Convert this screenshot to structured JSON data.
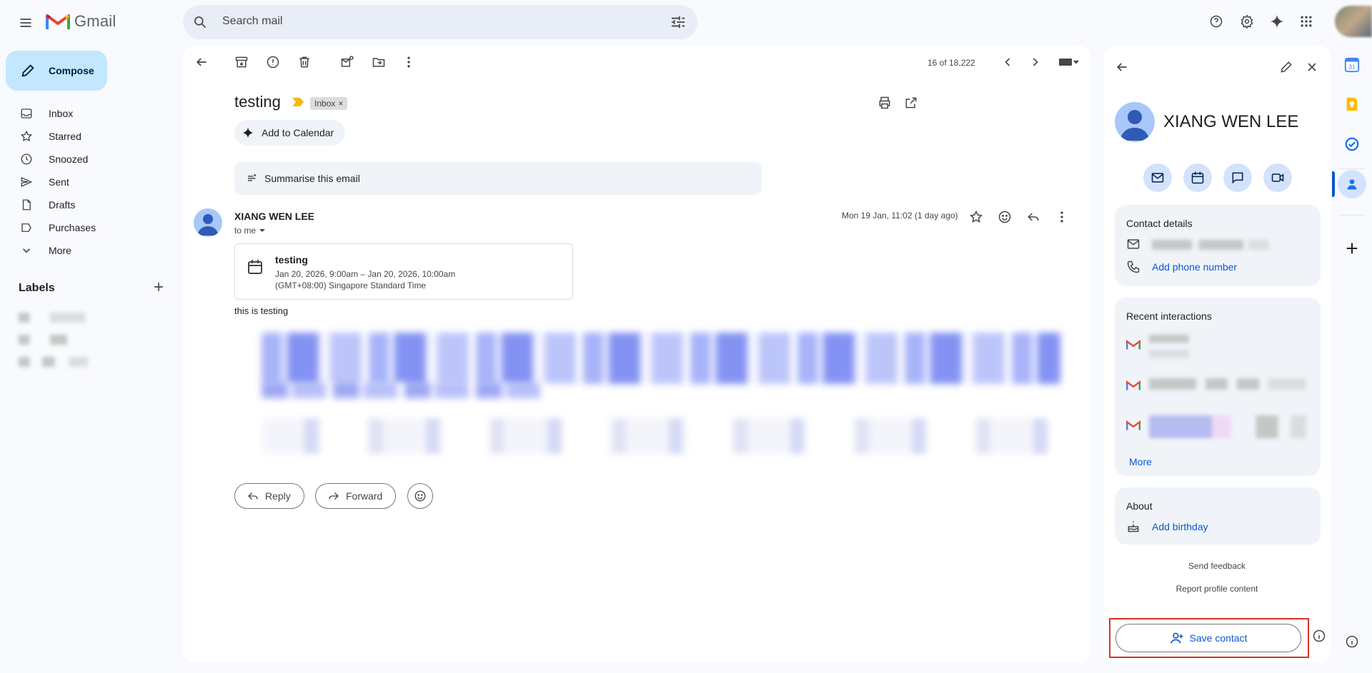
{
  "app": {
    "brand": "Gmail"
  },
  "search": {
    "placeholder": "Search mail"
  },
  "nav": {
    "compose_label": "Compose",
    "items": [
      {
        "label": "Inbox",
        "icon": "inbox-icon"
      },
      {
        "label": "Starred",
        "icon": "star-icon"
      },
      {
        "label": "Snoozed",
        "icon": "clock-icon"
      },
      {
        "label": "Sent",
        "icon": "send-icon"
      },
      {
        "label": "Drafts",
        "icon": "draft-icon"
      },
      {
        "label": "Purchases",
        "icon": "tag-icon"
      },
      {
        "label": "More",
        "icon": "chevron-down-icon"
      }
    ],
    "labels_title": "Labels"
  },
  "toolbar": {
    "page_count": "16 of 18,222"
  },
  "message": {
    "subject": "testing",
    "label_chip": "Inbox",
    "add_to_calendar": "Add to Calendar",
    "summarise": "Summarise this email",
    "sender_name": "XIANG WEN LEE",
    "to_me": "to me",
    "date": "Mon 19 Jan, 11:02 (1 day ago)",
    "event": {
      "title": "testing",
      "line1": "Jan 20, 2026, 9:00am – Jan 20, 2026, 10:00am",
      "line2": "(GMT+08:00) Singapore Standard Time"
    },
    "body": "this is testing",
    "reply_label": "Reply",
    "forward_label": "Forward"
  },
  "contact": {
    "name": "XIANG WEN LEE",
    "details_title": "Contact details",
    "add_phone": "Add phone number",
    "recent_title": "Recent interactions",
    "more_label": "More",
    "about_title": "About",
    "add_birthday": "Add birthday",
    "send_feedback": "Send feedback",
    "report_profile": "Report profile content",
    "save_contact": "Save contact"
  },
  "colors": {
    "accent": "#0b57d0",
    "compose_bg": "#c2e7ff",
    "highlight_border": "#d93025",
    "gmail_red": "#ea4335"
  }
}
